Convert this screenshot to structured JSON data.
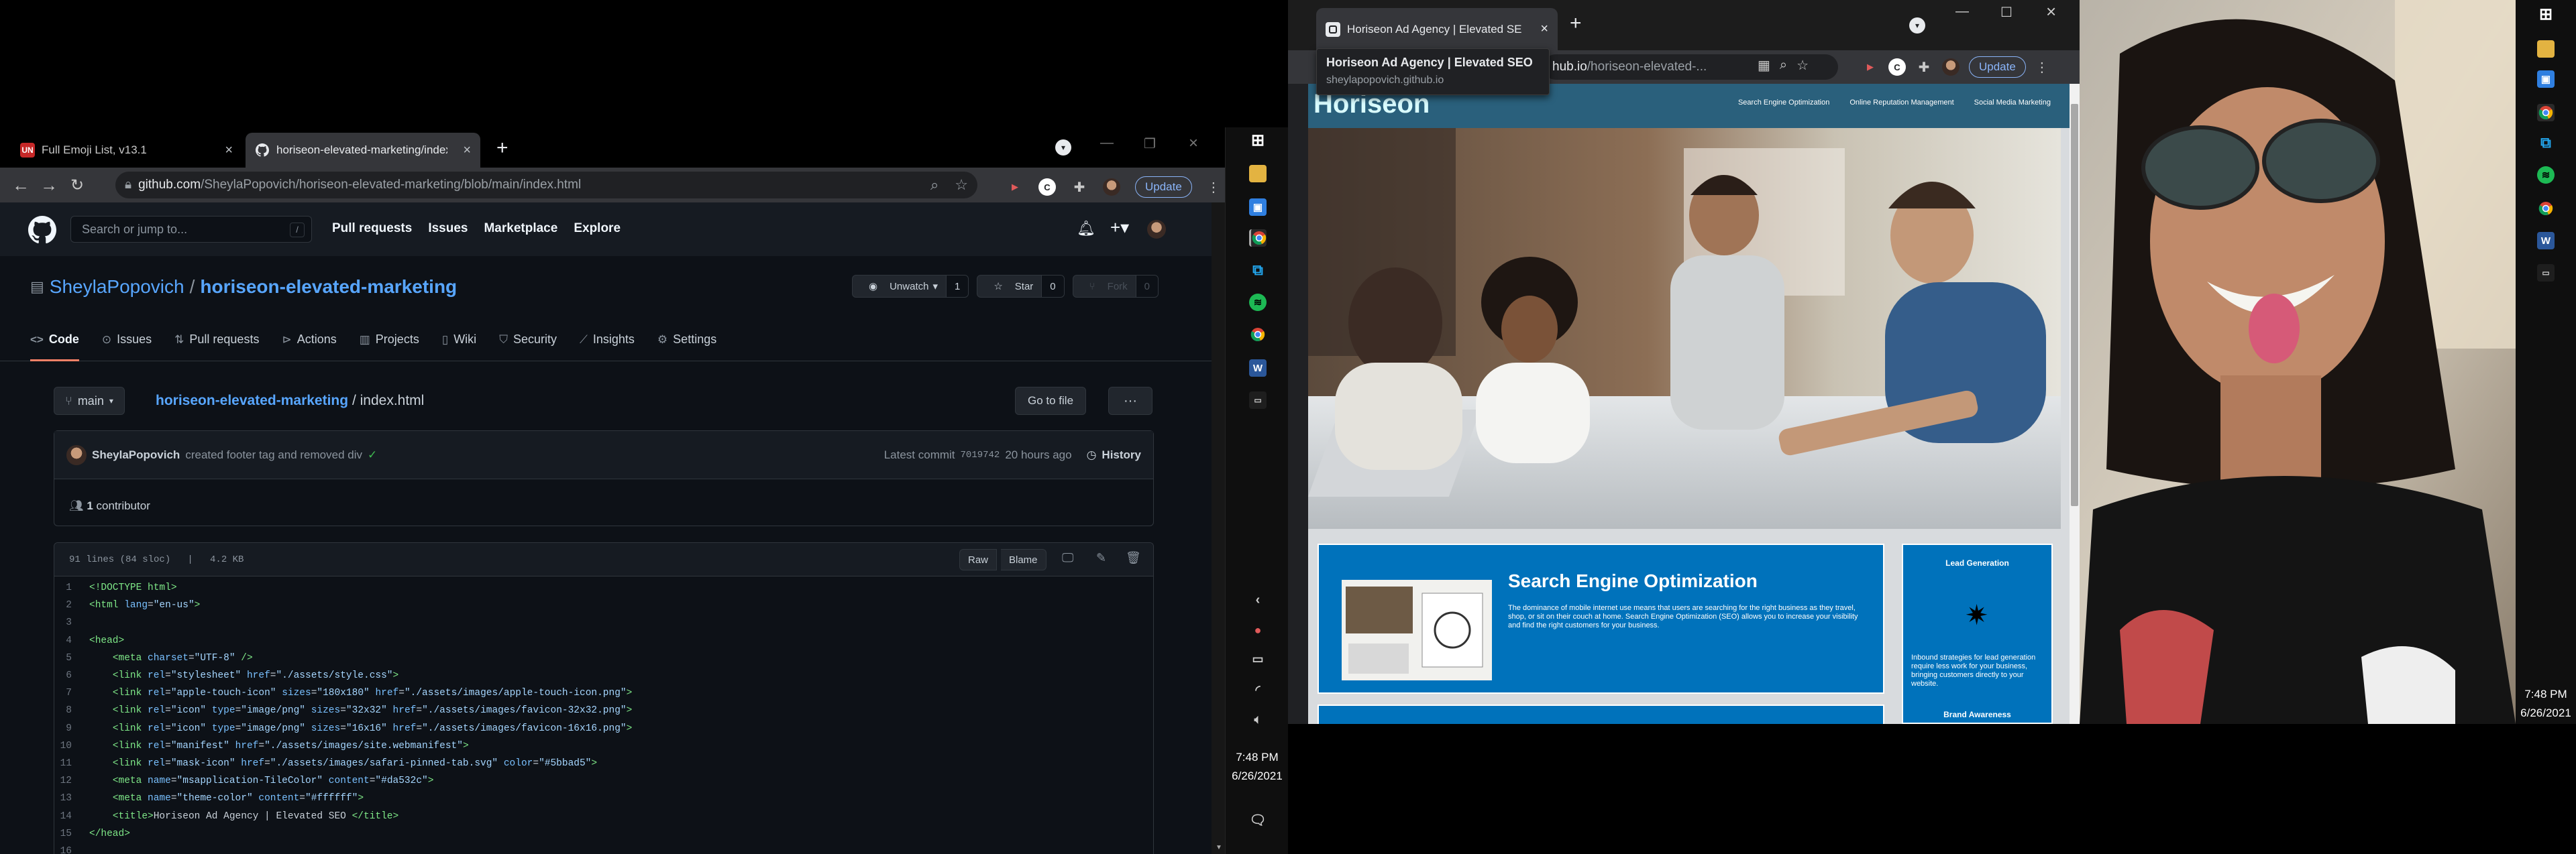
{
  "left_window": {
    "tabs": [
      {
        "label": "Full Emoji List, v13.1",
        "favicon": "UN"
      },
      {
        "label": "horiseon-elevated-marketing/index.h"
      }
    ],
    "url_domain": "github.com",
    "url_path": "/SheylaPopovich/horiseon-elevated-marketing/blob/main/index.html",
    "update_label": "Update",
    "github": {
      "search_placeholder": "Search or jump to...",
      "slash_key": "/",
      "nav": [
        "Pull requests",
        "Issues",
        "Marketplace",
        "Explore"
      ],
      "repo_owner": "SheylaPopovich",
      "repo_sep": "/",
      "repo_name": "horiseon-elevated-marketing",
      "unwatch": {
        "label": "Unwatch",
        "count": "1"
      },
      "star": {
        "label": "Star",
        "count": "0"
      },
      "fork": {
        "label": "Fork",
        "count": "0"
      },
      "tabs": [
        "Code",
        "Issues",
        "Pull requests",
        "Actions",
        "Projects",
        "Wiki",
        "Security",
        "Insights",
        "Settings"
      ],
      "branch": "main",
      "crumb_repo": "horiseon-elevated-marketing",
      "crumb_sep": "/",
      "crumb_file": "index.html",
      "goto_file": "Go to file",
      "more": "···",
      "commit_author": "SheylaPopovich",
      "commit_msg": "created footer tag and removed div",
      "commit_check": "✓",
      "latest_commit_label": "Latest commit",
      "commit_hash": "7019742",
      "commit_time": "20 hours ago",
      "history": "History",
      "contributors_count": "1",
      "contributors_label": "contributor",
      "file_info": "91 lines (84 sloc)   |   4.2 KB",
      "raw": "Raw",
      "blame": "Blame",
      "code_lines": [
        {
          "n": "1",
          "html": "<span class=\"tg\">&lt;!DOCTYPE html&gt;</span>"
        },
        {
          "n": "2",
          "html": "<span class=\"tg\">&lt;html</span> <span class=\"at\">lang</span>=<span class=\"st\">\"en-us\"</span><span class=\"tg\">&gt;</span>"
        },
        {
          "n": "3",
          "html": ""
        },
        {
          "n": "4",
          "html": "<span class=\"tg\">&lt;head&gt;</span>"
        },
        {
          "n": "5",
          "html": "    <span class=\"tg\">&lt;meta</span> <span class=\"at\">charset</span>=<span class=\"st\">\"UTF-8\"</span> <span class=\"tg\">/&gt;</span>"
        },
        {
          "n": "6",
          "html": "    <span class=\"tg\">&lt;link</span> <span class=\"at\">rel</span>=<span class=\"st\">\"stylesheet\"</span> <span class=\"at\">href</span>=<span class=\"st\">\"./assets/style.css\"</span><span class=\"tg\">&gt;</span>"
        },
        {
          "n": "7",
          "html": "    <span class=\"tg\">&lt;link</span> <span class=\"at\">rel</span>=<span class=\"st\">\"apple-touch-icon\"</span> <span class=\"at\">sizes</span>=<span class=\"st\">\"180x180\"</span> <span class=\"at\">href</span>=<span class=\"st\">\"./assets/images/apple-touch-icon.png\"</span><span class=\"tg\">&gt;</span>"
        },
        {
          "n": "8",
          "html": "    <span class=\"tg\">&lt;link</span> <span class=\"at\">rel</span>=<span class=\"st\">\"icon\"</span> <span class=\"at\">type</span>=<span class=\"st\">\"image/png\"</span> <span class=\"at\">sizes</span>=<span class=\"st\">\"32x32\"</span> <span class=\"at\">href</span>=<span class=\"st\">\"./assets/images/favicon-32x32.png\"</span><span class=\"tg\">&gt;</span>"
        },
        {
          "n": "9",
          "html": "    <span class=\"tg\">&lt;link</span> <span class=\"at\">rel</span>=<span class=\"st\">\"icon\"</span> <span class=\"at\">type</span>=<span class=\"st\">\"image/png\"</span> <span class=\"at\">sizes</span>=<span class=\"st\">\"16x16\"</span> <span class=\"at\">href</span>=<span class=\"st\">\"./assets/images/favicon-16x16.png\"</span><span class=\"tg\">&gt;</span>"
        },
        {
          "n": "10",
          "html": "    <span class=\"tg\">&lt;link</span> <span class=\"at\">rel</span>=<span class=\"st\">\"manifest\"</span> <span class=\"at\">href</span>=<span class=\"st\">\"./assets/images/site.webmanifest\"</span><span class=\"tg\">&gt;</span>"
        },
        {
          "n": "11",
          "html": "    <span class=\"tg\">&lt;link</span> <span class=\"at\">rel</span>=<span class=\"st\">\"mask-icon\"</span> <span class=\"at\">href</span>=<span class=\"st\">\"./assets/images/safari-pinned-tab.svg\"</span> <span class=\"at\">color</span>=<span class=\"st\">\"#5bbad5\"</span><span class=\"tg\">&gt;</span>"
        },
        {
          "n": "12",
          "html": "    <span class=\"tg\">&lt;meta</span> <span class=\"at\">name</span>=<span class=\"st\">\"msapplication-TileColor\"</span> <span class=\"at\">content</span>=<span class=\"st\">\"#da532c\"</span><span class=\"tg\">&gt;</span>"
        },
        {
          "n": "13",
          "html": "    <span class=\"tg\">&lt;meta</span> <span class=\"at\">name</span>=<span class=\"st\">\"theme-color\"</span> <span class=\"at\">content</span>=<span class=\"st\">\"#ffffff\"</span><span class=\"tg\">&gt;</span>"
        },
        {
          "n": "14",
          "html": "    <span class=\"tg\">&lt;title&gt;</span>Horiseon Ad Agency | Elevated SEO <span class=\"tg\">&lt;/title&gt;</span>"
        },
        {
          "n": "15",
          "html": "<span class=\"tg\">&lt;/head&gt;</span>"
        },
        {
          "n": "16",
          "html": ""
        }
      ]
    }
  },
  "taskbar_left": {
    "time": "7:48 PM",
    "date": "6/26/2021"
  },
  "right_window": {
    "tab_label": "Horiseon Ad Agency | Elevated SE",
    "tooltip_title": "Horiseon Ad Agency | Elevated SEO",
    "tooltip_url": "sheylapopovich.github.io",
    "url_domain": "hub.io",
    "url_path": "/horiseon-elevated-...",
    "update_label": "Update",
    "site": {
      "logo": "Horiseon",
      "nav": [
        "Search Engine Optimization",
        "Online Reputation Management",
        "Social Media Marketing"
      ],
      "seo_title": "Search Engine Optimization",
      "seo_text": "The dominance of mobile internet use means that users are searching for the right business as they travel, shop, or sit on their couch at home. Search Engine Optimization (SEO) allows you to increase your visibility and find the right customers for your business.",
      "side_title": "Lead Generation",
      "side_text": "Inbound strategies for lead generation require less work for your business, bringing customers directly to your website.",
      "side_title2": "Brand Awareness"
    }
  },
  "taskbar_right": {
    "time": "7:48 PM",
    "date": "6/26/2021"
  }
}
